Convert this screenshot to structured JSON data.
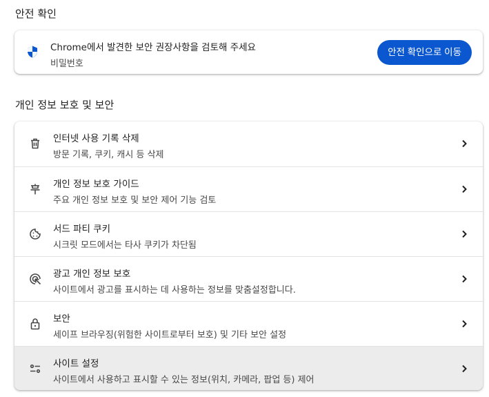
{
  "safety_check": {
    "section_title": "안전 확인",
    "card_title": "Chrome에서 발견한 보안 권장사항을 검토해 주세요",
    "card_subtitle": "비밀번호",
    "button_label": "안전 확인으로 이동",
    "button_color": "#0b57d0",
    "icon": "shield-icon"
  },
  "privacy": {
    "section_title": "개인 정보 보호 및 보안",
    "items": [
      {
        "title": "인터넷 사용 기록 삭제",
        "subtitle": "방문 기록, 쿠키, 캐시 등 삭제",
        "icon": "trash-icon"
      },
      {
        "title": "개인 정보 보호 가이드",
        "subtitle": "주요 개인 정보 보호 및 보안 제어 기능 검토",
        "icon": "privacy-guide-icon"
      },
      {
        "title": "서드 파티 쿠키",
        "subtitle": "시크릿 모드에서는 타사 쿠키가 차단됨",
        "icon": "cookie-icon"
      },
      {
        "title": "광고 개인 정보 보호",
        "subtitle": "사이트에서 광고를 표시하는 데 사용하는 정보를 맞춤설정합니다.",
        "icon": "ad-privacy-icon"
      },
      {
        "title": "보안",
        "subtitle": "세이프 브라우징(위험한 사이트로부터 보호) 및 기타 보안 설정",
        "icon": "lock-icon"
      },
      {
        "title": "사이트 설정",
        "subtitle": "사이트에서 사용하고 표시할 수 있는 정보(위치, 카메라, 팝업 등) 제어",
        "icon": "tune-icon"
      }
    ]
  }
}
